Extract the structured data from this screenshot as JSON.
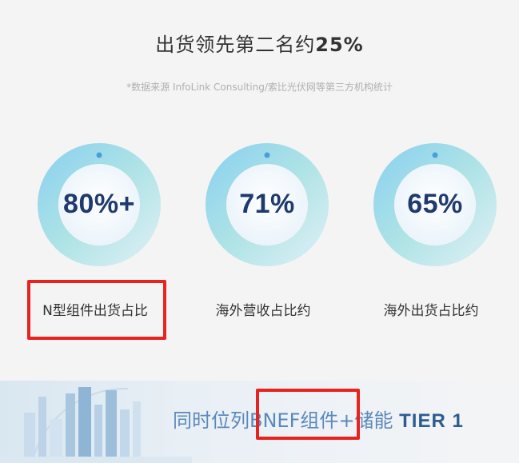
{
  "headline": {
    "text": "出货领先第二名约",
    "emphasis": "25%"
  },
  "source_note": "*数据来源 InfoLink Consulting/索比光伏网等第三方机构统计",
  "stats": [
    {
      "value": "80%+",
      "label": "N型组件出货占比"
    },
    {
      "value": "71%",
      "label": "海外营收占比约"
    },
    {
      "value": "65%",
      "label": "海外出货占比约"
    }
  ],
  "banner": {
    "text": "同时位列BNEF组件+储能",
    "emphasis": "TIER 1"
  },
  "colors": {
    "accent_red": "#e8231f",
    "value_navy": "#1e3a6e",
    "banner_blue": "#5a89bb"
  }
}
